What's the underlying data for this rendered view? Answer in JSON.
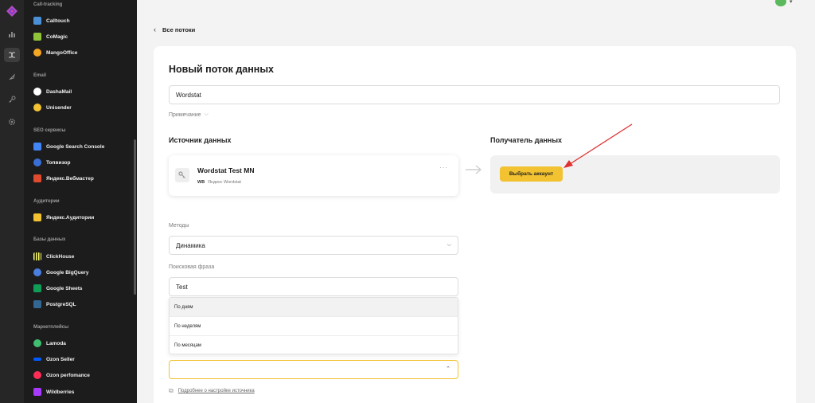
{
  "colors": {
    "accent": "#f2c231",
    "sidebar_bg": "#1c1c1c",
    "rail_bg": "#262626",
    "arrow_red": "#e03030"
  },
  "rail": {
    "icons": [
      "app-logo-icon",
      "chart-icon",
      "flows-icon",
      "rocket-icon",
      "key-icon",
      "settings-icon"
    ]
  },
  "sidebar": {
    "sections": [
      {
        "title": "Call-tracking",
        "items": [
          {
            "label": "Calltouch",
            "icon": "calltouch-icon",
            "color": "#4a8fd8"
          },
          {
            "label": "CoMagic",
            "icon": "comagic-icon",
            "color": "#8fc33a"
          },
          {
            "label": "MangoOffice",
            "icon": "mangooffice-icon",
            "color": "#f5a623"
          }
        ]
      },
      {
        "title": "Email",
        "items": [
          {
            "label": "DashaMail",
            "icon": "dashamail-icon",
            "color": "#ffffff"
          },
          {
            "label": "Unisender",
            "icon": "unisender-icon",
            "color": "#f2c231"
          }
        ]
      },
      {
        "title": "SEO сервисы",
        "items": [
          {
            "label": "Google Search Console",
            "icon": "google-search-console-icon",
            "color": "#4285f4"
          },
          {
            "label": "Топвизор",
            "icon": "topvisor-icon",
            "color": "#3b6fd8"
          },
          {
            "label": "Яндекс.Вебмастер",
            "icon": "yandex-webmaster-icon",
            "color": "#e04a2f"
          }
        ]
      },
      {
        "title": "Аудитории",
        "items": [
          {
            "label": "Яндекс.Аудитории",
            "icon": "yandex-audience-icon",
            "color": "#f2c231"
          }
        ]
      },
      {
        "title": "Базы данных",
        "items": [
          {
            "label": "ClickHouse",
            "icon": "clickhouse-icon",
            "color": "#faff69"
          },
          {
            "label": "Google BigQuery",
            "icon": "bigquery-icon",
            "color": "#4a7fe0"
          },
          {
            "label": "Google Sheets",
            "icon": "google-sheets-icon",
            "color": "#0f9d58"
          },
          {
            "label": "PostgreSQL",
            "icon": "postgresql-icon",
            "color": "#336791"
          }
        ]
      },
      {
        "title": "Маркетплейсы",
        "items": [
          {
            "label": "Lamoda",
            "icon": "lamoda-icon",
            "color": "#3fbf6f"
          },
          {
            "label": "Ozon Seller",
            "icon": "ozon-seller-icon",
            "color": "#005bff"
          },
          {
            "label": "Ozon perfomance",
            "icon": "ozon-performance-icon",
            "color": "#ff2d55"
          },
          {
            "label": "Wildberries",
            "icon": "wildberries-icon",
            "color": "#a73afd"
          }
        ]
      }
    ]
  },
  "header": {
    "back_label": "Все потоки"
  },
  "form": {
    "title": "Новый поток данных",
    "name_value": "Wordstat",
    "note_label": "Примечание",
    "source_heading": "Источник данных",
    "dest_heading": "Получатель данных",
    "source": {
      "name": "Wordstat Test MN",
      "badge": "WB",
      "subtitle": "Яндекс Wordstat"
    },
    "pick_account_label": "Выбрать аккаунт",
    "methods_label": "Методы",
    "methods_value": "Динамика",
    "phrase_label": "Поисковая фраза",
    "phrase_value": "Test",
    "dropdown_options": [
      "По дням",
      "По неделям",
      "По месяцам"
    ],
    "help_link": "Подробнее о настройке источника"
  }
}
